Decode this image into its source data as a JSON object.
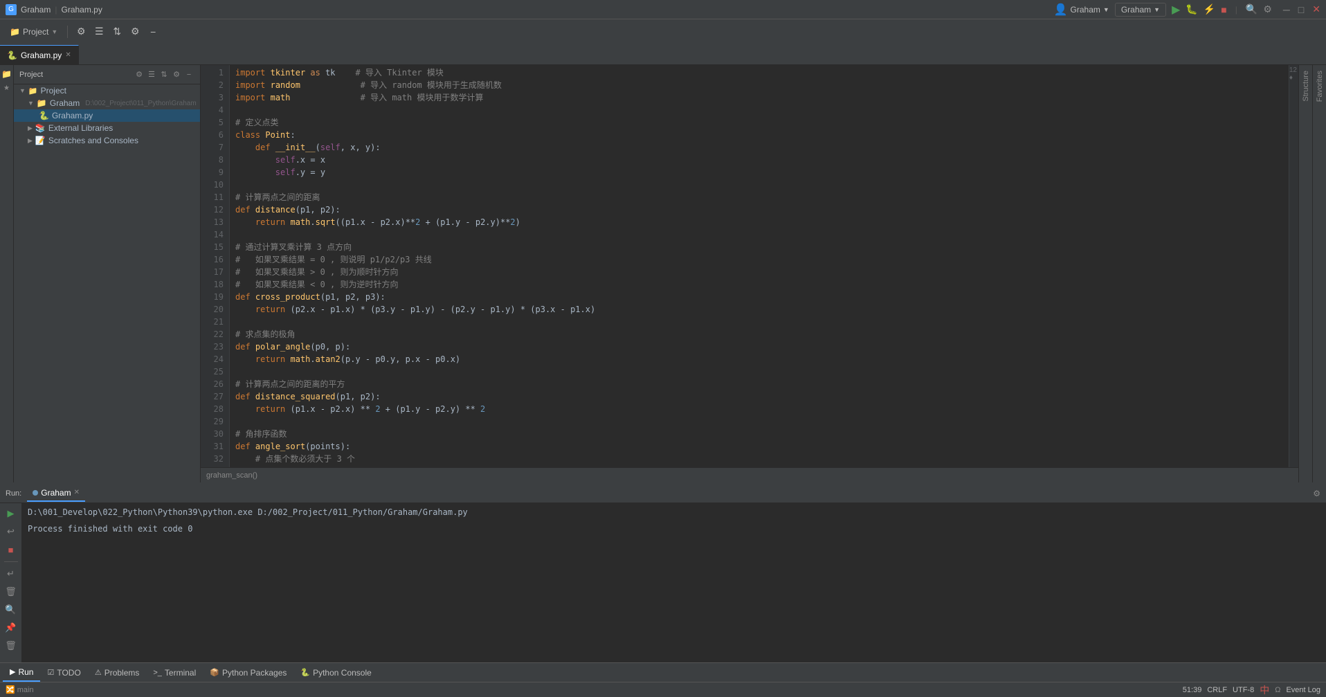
{
  "titleBar": {
    "appTitle": "Graham",
    "fileName": "Graham.py",
    "profileLabel": "Graham",
    "windowControls": [
      "minimize",
      "maximize",
      "close"
    ]
  },
  "toolbar": {
    "projectLabel": "Project",
    "buttons": [
      "settings",
      "list",
      "sort",
      "gear",
      "minus"
    ]
  },
  "tabs": [
    {
      "label": "Graham.py",
      "active": true,
      "modified": false
    }
  ],
  "projectTree": {
    "items": [
      {
        "label": "Project",
        "type": "root",
        "indent": 0,
        "expanded": true
      },
      {
        "label": "Graham",
        "path": "D:\\002_Project\\011_Python\\Graham",
        "type": "folder",
        "indent": 1,
        "expanded": true
      },
      {
        "label": "Graham.py",
        "type": "python",
        "indent": 2,
        "selected": true
      },
      {
        "label": "External Libraries",
        "type": "ext-lib",
        "indent": 1,
        "expanded": false
      },
      {
        "label": "Scratches and Consoles",
        "type": "scratches",
        "indent": 1,
        "expanded": false
      }
    ]
  },
  "editor": {
    "filename": "Graham.py",
    "lineCount": 32,
    "cursorInfo": "12 ♦",
    "breadcrumb": "graham_scan()",
    "lines": [
      {
        "num": 1,
        "code": "import tkinter as tk    # 导入 Tkinter 模块"
      },
      {
        "num": 2,
        "code": "import random            # 导入 random 模块用于生成随机数"
      },
      {
        "num": 3,
        "code": "import math              # 导入 math 模块用于数学计算"
      },
      {
        "num": 4,
        "code": ""
      },
      {
        "num": 5,
        "code": "# 定义点类"
      },
      {
        "num": 6,
        "code": "class Point:"
      },
      {
        "num": 7,
        "code": "    def __init__(self, x, y):"
      },
      {
        "num": 8,
        "code": "        self.x = x"
      },
      {
        "num": 9,
        "code": "        self.y = y"
      },
      {
        "num": 10,
        "code": ""
      },
      {
        "num": 11,
        "code": "# 计算两点之间的距离"
      },
      {
        "num": 12,
        "code": "def distance(p1, p2):"
      },
      {
        "num": 13,
        "code": "    return math.sqrt((p1.x - p2.x)**2 + (p1.y - p2.y)**2)"
      },
      {
        "num": 14,
        "code": ""
      },
      {
        "num": 15,
        "code": "# 通过计算叉乘计算 3 点方向"
      },
      {
        "num": 16,
        "code": "#   如果叉乘结果 = 0 , 则说明 p1/p2/p3 共线"
      },
      {
        "num": 17,
        "code": "#   如果叉乘结果 > 0 , 则为顺时针方向"
      },
      {
        "num": 18,
        "code": "#   如果叉乘结果 < 0 , 则为逆时针方向"
      },
      {
        "num": 19,
        "code": "def cross_product(p1, p2, p3):"
      },
      {
        "num": 20,
        "code": "    return (p2.x - p1.x) * (p3.y - p1.y) - (p2.y - p1.y) * (p3.x - p1.x)"
      },
      {
        "num": 21,
        "code": ""
      },
      {
        "num": 22,
        "code": "# 求点集的极角"
      },
      {
        "num": 23,
        "code": "def polar_angle(p0, p):"
      },
      {
        "num": 24,
        "code": "    return math.atan2(p.y - p0.y, p.x - p0.x)"
      },
      {
        "num": 25,
        "code": ""
      },
      {
        "num": 26,
        "code": "# 计算两点之间的距离的平方"
      },
      {
        "num": 27,
        "code": "def distance_squared(p1, p2):"
      },
      {
        "num": 28,
        "code": "    return (p1.x - p2.x) ** 2 + (p1.y - p2.y) ** 2"
      },
      {
        "num": 29,
        "code": ""
      },
      {
        "num": 30,
        "code": "# 角排序函数"
      },
      {
        "num": 31,
        "code": "def angle_sort(points):"
      },
      {
        "num": 32,
        "code": "    # 点集个数必须大于 3 个"
      }
    ]
  },
  "runPanel": {
    "tabLabel": "Run",
    "configLabel": "Graham",
    "command": "D:\\001_Develop\\022_Python\\Python39\\python.exe D:/002_Project/011_Python/Graham/Graham.py",
    "output": "Process finished with exit code 0"
  },
  "bottomTabs": [
    {
      "label": "Run",
      "icon": "▶",
      "active": true
    },
    {
      "label": "TODO",
      "icon": "☑",
      "active": false
    },
    {
      "label": "Problems",
      "icon": "⚠",
      "active": false
    },
    {
      "label": "Terminal",
      "icon": ">_",
      "active": false
    },
    {
      "label": "Python Packages",
      "icon": "📦",
      "active": false
    },
    {
      "label": "Python Console",
      "icon": "🐍",
      "active": false
    }
  ],
  "statusBar": {
    "position": "51:39",
    "lineEnding": "CRLF",
    "encoding": "UTF-8",
    "eventLog": "Event Log"
  }
}
